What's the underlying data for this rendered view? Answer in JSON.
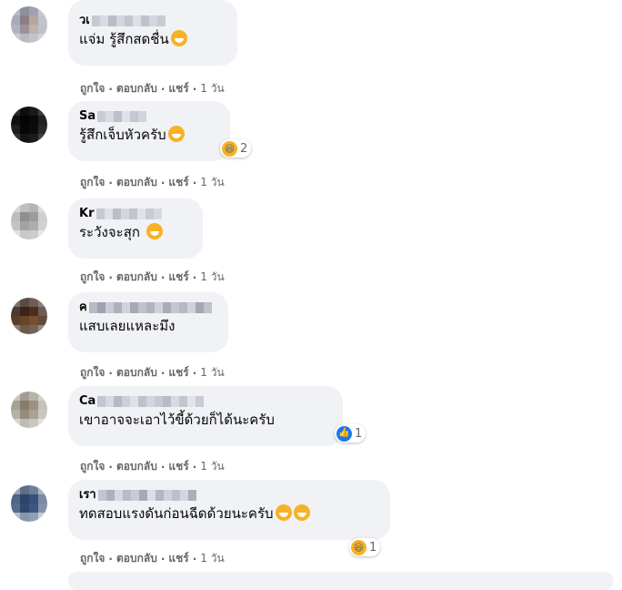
{
  "actions": {
    "like": "ถูกใจ",
    "reply": "ตอบกลับ",
    "share": "แชร์",
    "sep": "·"
  },
  "comments": [
    {
      "author_visible": "วเ",
      "text": "แจ่ม รู้สึกสดชื่น",
      "text_emoji": "crying-laughing-cat-emoji",
      "time": "1 วัน"
    },
    {
      "author_visible": "Sa",
      "text": "รู้สึกเจ็บหัวครับ",
      "text_emoji": "grinning-sweat-emoji",
      "reaction": {
        "icon": "haha-reaction-icon",
        "count": "2"
      },
      "time": "1 วัน"
    },
    {
      "author_visible": "Kr",
      "text": "ระวังจะสุก",
      "text_emoji": "rolling-laughing-emoji",
      "time": "1 วัน"
    },
    {
      "author_visible": "ค",
      "text": "แสบเลยแหละมึง",
      "time": "1 วัน"
    },
    {
      "author_visible": "Ca",
      "text": "เขาอาจจะเอาไว้ขี้ด้วยก็ได้นะครับ",
      "reaction": {
        "icon": "like-reaction-icon",
        "count": "1"
      },
      "time": "1 วัน"
    },
    {
      "author_visible": "เรา",
      "text": "ทดสอบแรงดันก่อนฉีดด้วยนะครับ",
      "text_emoji": "beaming-grin-emoji",
      "reaction": {
        "icon": "haha-reaction-icon",
        "count": "1"
      },
      "time": "1 วัน"
    }
  ]
}
